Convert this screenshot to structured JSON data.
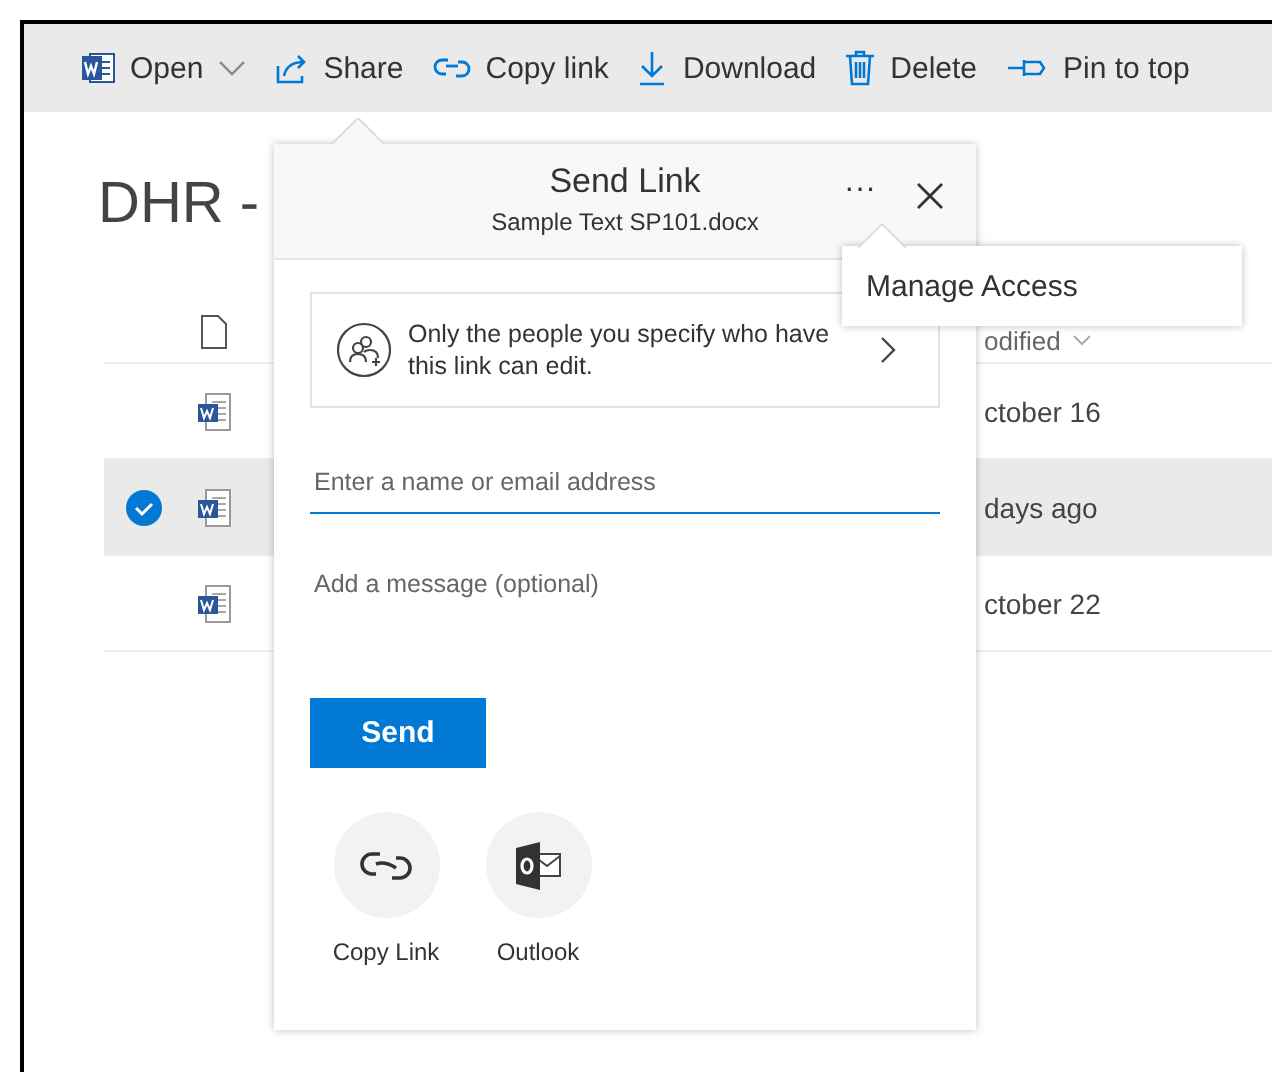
{
  "toolbar": [
    {
      "kind": "word",
      "label": "Open",
      "caret": true
    },
    {
      "kind": "share",
      "label": "Share",
      "caret": false
    },
    {
      "kind": "link",
      "label": "Copy link",
      "caret": false
    },
    {
      "kind": "download",
      "label": "Download",
      "caret": false
    },
    {
      "kind": "delete",
      "label": "Delete",
      "caret": false
    },
    {
      "kind": "pin",
      "label": "Pin to top",
      "caret": false
    }
  ],
  "page_title": "DHR -",
  "list": {
    "modified_header": "odified",
    "rows": [
      {
        "modified": "ctober 16",
        "selected": false
      },
      {
        "modified": "days ago",
        "selected": true
      },
      {
        "modified": "ctober 22",
        "selected": false
      }
    ]
  },
  "dialog": {
    "title": "Send Link",
    "file": "Sample Text SP101.docx",
    "more": "···",
    "permission": "Only the people you specify who have this link can edit.",
    "recipient_placeholder": "Enter a name or email address",
    "message_placeholder": "Add a message (optional)",
    "send": "Send",
    "share_options": [
      {
        "kind": "link",
        "label": "Copy Link"
      },
      {
        "kind": "outlook",
        "label": "Outlook"
      }
    ]
  },
  "menu": {
    "items": [
      "Manage Access"
    ]
  }
}
